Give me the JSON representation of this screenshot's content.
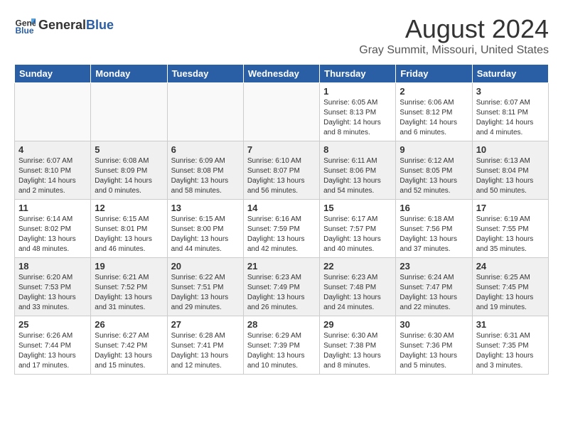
{
  "header": {
    "logo_general": "General",
    "logo_blue": "Blue",
    "month_year": "August 2024",
    "location": "Gray Summit, Missouri, United States"
  },
  "days_of_week": [
    "Sunday",
    "Monday",
    "Tuesday",
    "Wednesday",
    "Thursday",
    "Friday",
    "Saturday"
  ],
  "weeks": [
    {
      "shaded": false,
      "days": [
        {
          "num": "",
          "empty": true
        },
        {
          "num": "",
          "empty": true
        },
        {
          "num": "",
          "empty": true
        },
        {
          "num": "",
          "empty": true
        },
        {
          "num": "1",
          "empty": false,
          "info": "Sunrise: 6:05 AM\nSunset: 8:13 PM\nDaylight: 14 hours\nand 8 minutes."
        },
        {
          "num": "2",
          "empty": false,
          "info": "Sunrise: 6:06 AM\nSunset: 8:12 PM\nDaylight: 14 hours\nand 6 minutes."
        },
        {
          "num": "3",
          "empty": false,
          "info": "Sunrise: 6:07 AM\nSunset: 8:11 PM\nDaylight: 14 hours\nand 4 minutes."
        }
      ]
    },
    {
      "shaded": true,
      "days": [
        {
          "num": "4",
          "empty": false,
          "info": "Sunrise: 6:07 AM\nSunset: 8:10 PM\nDaylight: 14 hours\nand 2 minutes."
        },
        {
          "num": "5",
          "empty": false,
          "info": "Sunrise: 6:08 AM\nSunset: 8:09 PM\nDaylight: 14 hours\nand 0 minutes."
        },
        {
          "num": "6",
          "empty": false,
          "info": "Sunrise: 6:09 AM\nSunset: 8:08 PM\nDaylight: 13 hours\nand 58 minutes."
        },
        {
          "num": "7",
          "empty": false,
          "info": "Sunrise: 6:10 AM\nSunset: 8:07 PM\nDaylight: 13 hours\nand 56 minutes."
        },
        {
          "num": "8",
          "empty": false,
          "info": "Sunrise: 6:11 AM\nSunset: 8:06 PM\nDaylight: 13 hours\nand 54 minutes."
        },
        {
          "num": "9",
          "empty": false,
          "info": "Sunrise: 6:12 AM\nSunset: 8:05 PM\nDaylight: 13 hours\nand 52 minutes."
        },
        {
          "num": "10",
          "empty": false,
          "info": "Sunrise: 6:13 AM\nSunset: 8:04 PM\nDaylight: 13 hours\nand 50 minutes."
        }
      ]
    },
    {
      "shaded": false,
      "days": [
        {
          "num": "11",
          "empty": false,
          "info": "Sunrise: 6:14 AM\nSunset: 8:02 PM\nDaylight: 13 hours\nand 48 minutes."
        },
        {
          "num": "12",
          "empty": false,
          "info": "Sunrise: 6:15 AM\nSunset: 8:01 PM\nDaylight: 13 hours\nand 46 minutes."
        },
        {
          "num": "13",
          "empty": false,
          "info": "Sunrise: 6:15 AM\nSunset: 8:00 PM\nDaylight: 13 hours\nand 44 minutes."
        },
        {
          "num": "14",
          "empty": false,
          "info": "Sunrise: 6:16 AM\nSunset: 7:59 PM\nDaylight: 13 hours\nand 42 minutes."
        },
        {
          "num": "15",
          "empty": false,
          "info": "Sunrise: 6:17 AM\nSunset: 7:57 PM\nDaylight: 13 hours\nand 40 minutes."
        },
        {
          "num": "16",
          "empty": false,
          "info": "Sunrise: 6:18 AM\nSunset: 7:56 PM\nDaylight: 13 hours\nand 37 minutes."
        },
        {
          "num": "17",
          "empty": false,
          "info": "Sunrise: 6:19 AM\nSunset: 7:55 PM\nDaylight: 13 hours\nand 35 minutes."
        }
      ]
    },
    {
      "shaded": true,
      "days": [
        {
          "num": "18",
          "empty": false,
          "info": "Sunrise: 6:20 AM\nSunset: 7:53 PM\nDaylight: 13 hours\nand 33 minutes."
        },
        {
          "num": "19",
          "empty": false,
          "info": "Sunrise: 6:21 AM\nSunset: 7:52 PM\nDaylight: 13 hours\nand 31 minutes."
        },
        {
          "num": "20",
          "empty": false,
          "info": "Sunrise: 6:22 AM\nSunset: 7:51 PM\nDaylight: 13 hours\nand 29 minutes."
        },
        {
          "num": "21",
          "empty": false,
          "info": "Sunrise: 6:23 AM\nSunset: 7:49 PM\nDaylight: 13 hours\nand 26 minutes."
        },
        {
          "num": "22",
          "empty": false,
          "info": "Sunrise: 6:23 AM\nSunset: 7:48 PM\nDaylight: 13 hours\nand 24 minutes."
        },
        {
          "num": "23",
          "empty": false,
          "info": "Sunrise: 6:24 AM\nSunset: 7:47 PM\nDaylight: 13 hours\nand 22 minutes."
        },
        {
          "num": "24",
          "empty": false,
          "info": "Sunrise: 6:25 AM\nSunset: 7:45 PM\nDaylight: 13 hours\nand 19 minutes."
        }
      ]
    },
    {
      "shaded": false,
      "days": [
        {
          "num": "25",
          "empty": false,
          "info": "Sunrise: 6:26 AM\nSunset: 7:44 PM\nDaylight: 13 hours\nand 17 minutes."
        },
        {
          "num": "26",
          "empty": false,
          "info": "Sunrise: 6:27 AM\nSunset: 7:42 PM\nDaylight: 13 hours\nand 15 minutes."
        },
        {
          "num": "27",
          "empty": false,
          "info": "Sunrise: 6:28 AM\nSunset: 7:41 PM\nDaylight: 13 hours\nand 12 minutes."
        },
        {
          "num": "28",
          "empty": false,
          "info": "Sunrise: 6:29 AM\nSunset: 7:39 PM\nDaylight: 13 hours\nand 10 minutes."
        },
        {
          "num": "29",
          "empty": false,
          "info": "Sunrise: 6:30 AM\nSunset: 7:38 PM\nDaylight: 13 hours\nand 8 minutes."
        },
        {
          "num": "30",
          "empty": false,
          "info": "Sunrise: 6:30 AM\nSunset: 7:36 PM\nDaylight: 13 hours\nand 5 minutes."
        },
        {
          "num": "31",
          "empty": false,
          "info": "Sunrise: 6:31 AM\nSunset: 7:35 PM\nDaylight: 13 hours\nand 3 minutes."
        }
      ]
    }
  ]
}
